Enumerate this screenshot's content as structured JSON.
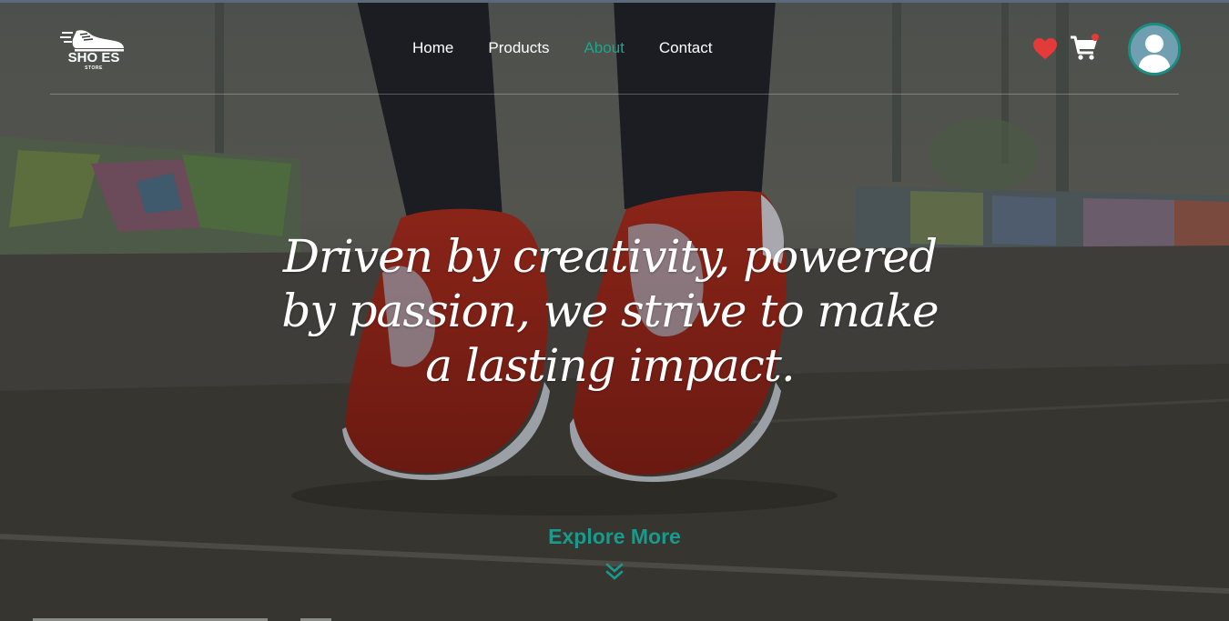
{
  "logo": {
    "name": "SHO ES",
    "sub": "STORE"
  },
  "nav": {
    "items": [
      {
        "label": "Home",
        "active": false
      },
      {
        "label": "Products",
        "active": false
      },
      {
        "label": "About",
        "active": true
      },
      {
        "label": "Contact",
        "active": false
      }
    ]
  },
  "header_icons": {
    "wishlist_icon": "heart-icon",
    "cart_icon": "cart-icon",
    "profile_icon": "user-avatar-icon"
  },
  "hero": {
    "quote": "Driven by creativity, powered by passion, we strive to make a lasting impact.",
    "cta_label": "Explore More",
    "cta_icon": "double-chevron-down-icon"
  },
  "colors": {
    "accent": "#1ea58a",
    "heart": "#e53a3a",
    "avatar_ring": "#1a8e82"
  }
}
